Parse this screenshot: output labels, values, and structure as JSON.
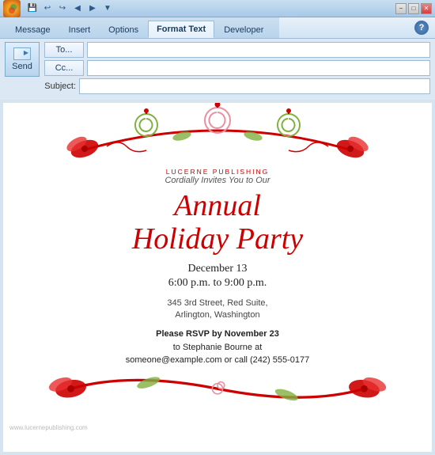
{
  "titlebar": {
    "office_label": "W",
    "window_controls": [
      "−",
      "□",
      "✕"
    ]
  },
  "quickaccess": {
    "icons": [
      "💾",
      "↩",
      "↪",
      "◀",
      "▶",
      "▼"
    ]
  },
  "ribbon": {
    "tabs": [
      "Message",
      "Insert",
      "Options",
      "Format Text",
      "Developer"
    ],
    "active_tab": "Message",
    "help_label": "?"
  },
  "compose": {
    "send_label": "Send",
    "to_label": "To...",
    "cc_label": "Cc...",
    "subject_label": "Subject:",
    "to_value": "",
    "cc_value": "",
    "subject_value": ""
  },
  "invitation": {
    "publisher": "LUCERNE PUBLISHING",
    "cordially": "Cordially Invites You to Our",
    "annual": "Annual",
    "holiday_party": "Holiday Party",
    "date": "December 13",
    "time": "6:00 p.m. to 9:00 p.m.",
    "address_line1": "345 3rd Street, Red Suite,",
    "address_line2": "Arlington, Washington",
    "rsvp_line1": "Please RSVP by November 23",
    "rsvp_line2": "to  Stephanie Bourne at",
    "rsvp_line3": "someone@example.com or call (242) 555-0177"
  },
  "watermark": {
    "text": "www.lucernepublishing.com"
  },
  "colors": {
    "red": "#cc0000",
    "ribbon_bg": "#d0e4f4",
    "body_bg": "#e8f0f8"
  }
}
